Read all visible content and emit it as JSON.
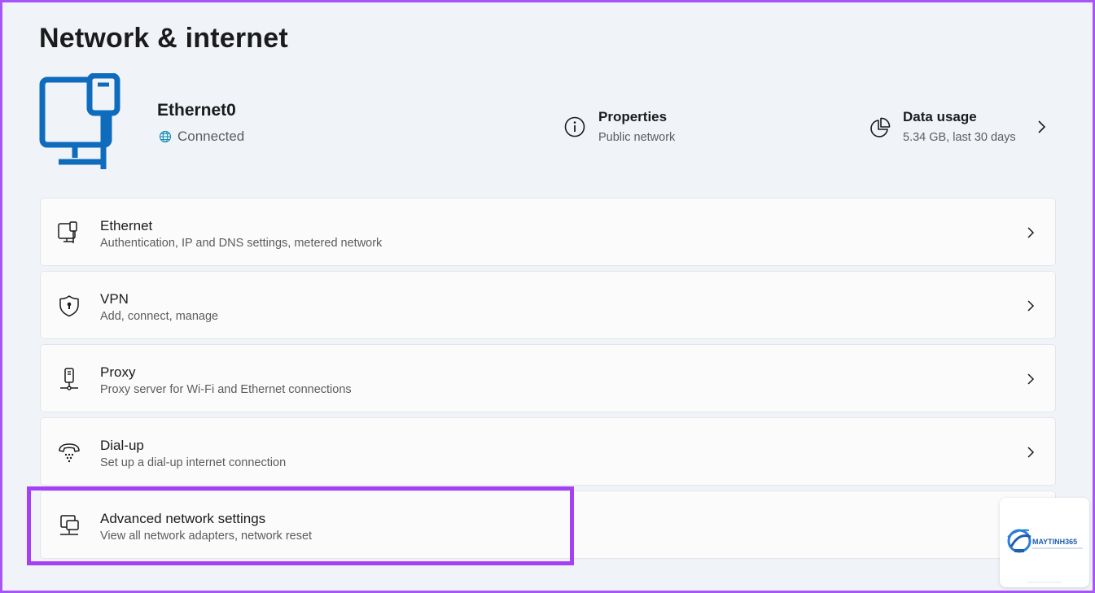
{
  "page": {
    "title": "Network & internet"
  },
  "connection": {
    "name": "Ethernet0",
    "status": "Connected"
  },
  "properties": {
    "title": "Properties",
    "subtitle": "Public network"
  },
  "data_usage": {
    "title": "Data usage",
    "subtitle": "5.34 GB, last 30 days"
  },
  "cards": [
    {
      "title": "Ethernet",
      "subtitle": "Authentication, IP and DNS settings, metered network"
    },
    {
      "title": "VPN",
      "subtitle": "Add, connect, manage"
    },
    {
      "title": "Proxy",
      "subtitle": "Proxy server for Wi-Fi and Ethernet connections"
    },
    {
      "title": "Dial-up",
      "subtitle": "Set up a dial-up internet connection"
    },
    {
      "title": "Advanced network settings",
      "subtitle": "View all network adapters, network reset"
    }
  ],
  "watermark": {
    "brand": "MAYTINH365"
  },
  "colors": {
    "accent": "#0f6cbd",
    "highlight": "#a640f3",
    "frame": "#a855f7",
    "background": "#f0f4f9"
  }
}
